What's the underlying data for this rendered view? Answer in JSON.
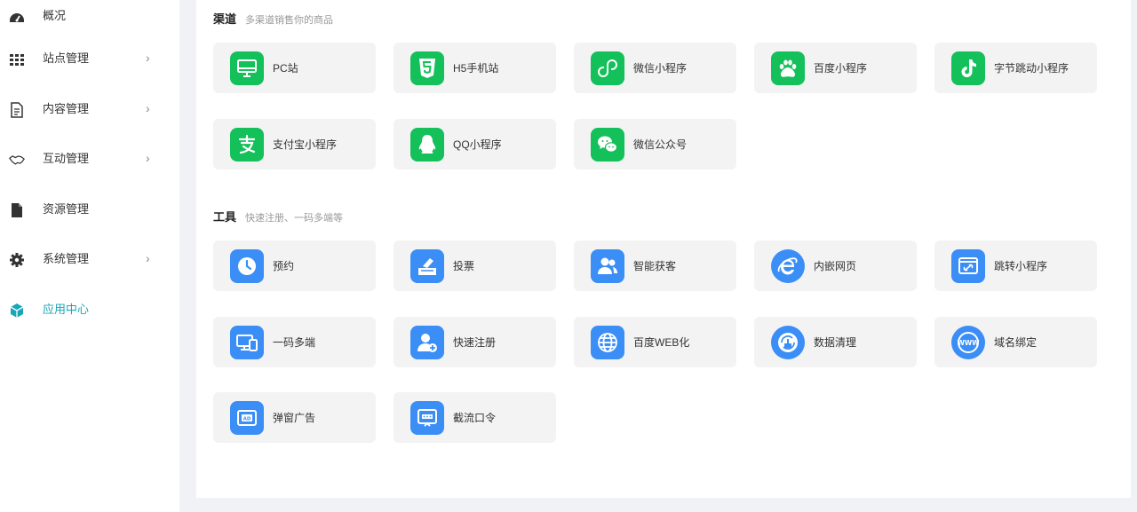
{
  "sidebar": {
    "items": [
      {
        "label": "概况",
        "icon": "dashboard-icon",
        "chevron": ""
      },
      {
        "label": "站点管理",
        "icon": "grid-icon",
        "chevron": "›"
      },
      {
        "label": "内容管理",
        "icon": "document-icon",
        "chevron": "›"
      },
      {
        "label": "互动管理",
        "icon": "handshake-icon",
        "chevron": "›"
      },
      {
        "label": "资源管理",
        "icon": "file-icon",
        "chevron": ""
      },
      {
        "label": "系统管理",
        "icon": "gear-icon",
        "chevron": "›"
      },
      {
        "label": "应用中心",
        "icon": "cube-icon",
        "chevron": "",
        "active": true
      }
    ]
  },
  "channels": {
    "title": "渠道",
    "subtitle": "多渠道销售你的商品",
    "items": [
      {
        "label": "PC站",
        "icon": "monitor-icon"
      },
      {
        "label": "H5手机站",
        "icon": "html5-icon"
      },
      {
        "label": "微信小程序",
        "icon": "miniprogram-icon"
      },
      {
        "label": "百度小程序",
        "icon": "baidu-paw-icon"
      },
      {
        "label": "字节跳动小程序",
        "icon": "douyin-icon"
      },
      {
        "label": "支付宝小程序",
        "icon": "alipay-icon"
      },
      {
        "label": "QQ小程序",
        "icon": "qq-penguin-icon"
      },
      {
        "label": "微信公众号",
        "icon": "wechat-icon"
      }
    ]
  },
  "tools": {
    "title": "工具",
    "subtitle": "快速注册、一码多端等",
    "items": [
      {
        "label": "预约",
        "icon": "clock-icon"
      },
      {
        "label": "投票",
        "icon": "ballot-icon"
      },
      {
        "label": "智能获客",
        "icon": "users-icon"
      },
      {
        "label": "内嵌网页",
        "icon": "ie-browser-icon"
      },
      {
        "label": "跳转小程序",
        "icon": "link-window-icon"
      },
      {
        "label": "一码多端",
        "icon": "multi-device-icon"
      },
      {
        "label": "快速注册",
        "icon": "add-user-icon"
      },
      {
        "label": "百度WEB化",
        "icon": "globe-icon"
      },
      {
        "label": "数据清理",
        "icon": "data-clean-icon"
      },
      {
        "label": "域名绑定",
        "icon": "www-icon"
      },
      {
        "label": "弹窗广告",
        "icon": "ad-popup-icon"
      },
      {
        "label": "截流口令",
        "icon": "password-icon"
      }
    ]
  },
  "colors": {
    "channel_green": "#14c05a",
    "tool_blue": "#3a8ef6",
    "active_teal": "#1aa6b7"
  }
}
